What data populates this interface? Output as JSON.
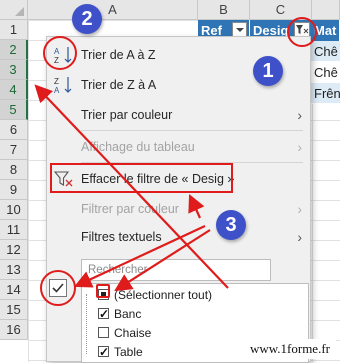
{
  "sheet": {
    "columns": [
      "A",
      "B",
      "C"
    ],
    "rows": [
      "1",
      "2",
      "3",
      "4",
      "5",
      "6",
      "7",
      "8",
      "9",
      "10",
      "11",
      "12",
      "13",
      "14",
      "15",
      "16"
    ],
    "table_headers": [
      "Ref",
      "Desig",
      "Mat"
    ],
    "cells": [
      "Chê",
      "Chê",
      "Frên"
    ]
  },
  "menu": {
    "sort_az": "Trier de A à Z",
    "sort_za": "Trier de Z à A",
    "sort_color": "Trier par couleur",
    "sheet_view": "Affichage du tableau",
    "clear_filter": "Effacer le filtre de « Desig »",
    "filter_color": "Filtrer par couleur",
    "text_filters": "Filtres textuels",
    "search_placeholder": "Rechercher",
    "list": [
      {
        "label": "(Sélectionner tout)",
        "state": "mixed"
      },
      {
        "label": "Banc",
        "state": "checked"
      },
      {
        "label": "Chaise",
        "state": "unchecked"
      },
      {
        "label": "Table",
        "state": "checked"
      }
    ]
  },
  "annotations": {
    "callouts": [
      "1",
      "2",
      "3"
    ],
    "callout_color": "#3f51c8",
    "highlight_color": "#e01b1b"
  },
  "watermark": "www.1forme.fr",
  "colors": {
    "table_header": "#2f75b5",
    "row_band": "#ddebf7",
    "menu_bg": "#f0f0f0"
  }
}
